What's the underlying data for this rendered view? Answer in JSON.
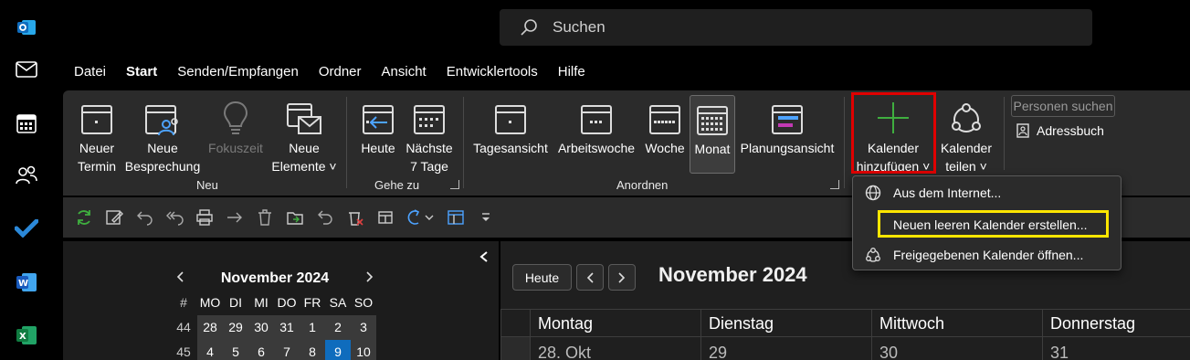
{
  "search": {
    "placeholder": "Suchen"
  },
  "menu_tabs": [
    "Datei",
    "Start",
    "Senden/Empfangen",
    "Ordner",
    "Ansicht",
    "Entwicklertools",
    "Hilfe"
  ],
  "active_tab": "Start",
  "rail_icons": [
    "outlook-icon",
    "mail-icon",
    "calendar-icon",
    "people-icon",
    "todo-icon",
    "word-icon",
    "excel-icon"
  ],
  "ribbon": {
    "neuer_termin": [
      "Neuer",
      "Termin"
    ],
    "neue_besprechung": [
      "Neue",
      "Besprechung"
    ],
    "fokuszeit": "Fokuszeit",
    "neue_elemente": [
      "Neue",
      "Elemente ˅"
    ],
    "group_neu": "Neu",
    "heute": "Heute",
    "naechste": [
      "Nächste",
      "7 Tage"
    ],
    "group_gehe_zu": "Gehe zu",
    "tagesansicht": "Tagesansicht",
    "arbeitswoche": "Arbeitswoche",
    "woche": "Woche",
    "monat": "Monat",
    "planungsansicht": "Planungsansicht",
    "group_anordnen": "Anordnen",
    "kalender_hinzufuegen": [
      "Kalender",
      "hinzufügen ˅"
    ],
    "kalender_teilen": [
      "Kalender",
      "teilen ˅"
    ],
    "personen_suchen": "Personen suchen",
    "adressbuch": "Adressbuch"
  },
  "dropdown": {
    "items": [
      "Aus dem Internet...",
      "Neuen leeren Kalender erstellen...",
      "Freigegebenen Kalender öffnen..."
    ]
  },
  "mini_calendar": {
    "title": "November 2024",
    "header": [
      "#",
      "MO",
      "DI",
      "MI",
      "DO",
      "FR",
      "SA",
      "SO"
    ],
    "rows": [
      [
        "44",
        "28",
        "29",
        "30",
        "31",
        "1",
        "2",
        "3"
      ],
      [
        "45",
        "4",
        "5",
        "6",
        "7",
        "8",
        "9",
        "10"
      ]
    ],
    "today": "9"
  },
  "main_calendar": {
    "today_button": "Heute",
    "title": "November 2024",
    "days": [
      "Montag",
      "Dienstag",
      "Mittwoch",
      "Donnerstag"
    ],
    "dates": [
      "28. Okt",
      "29",
      "30",
      "31"
    ]
  },
  "colors": {
    "accent": "#0f6cbd",
    "highlight_red": "#e00000",
    "highlight_yellow": "#ffe600"
  }
}
